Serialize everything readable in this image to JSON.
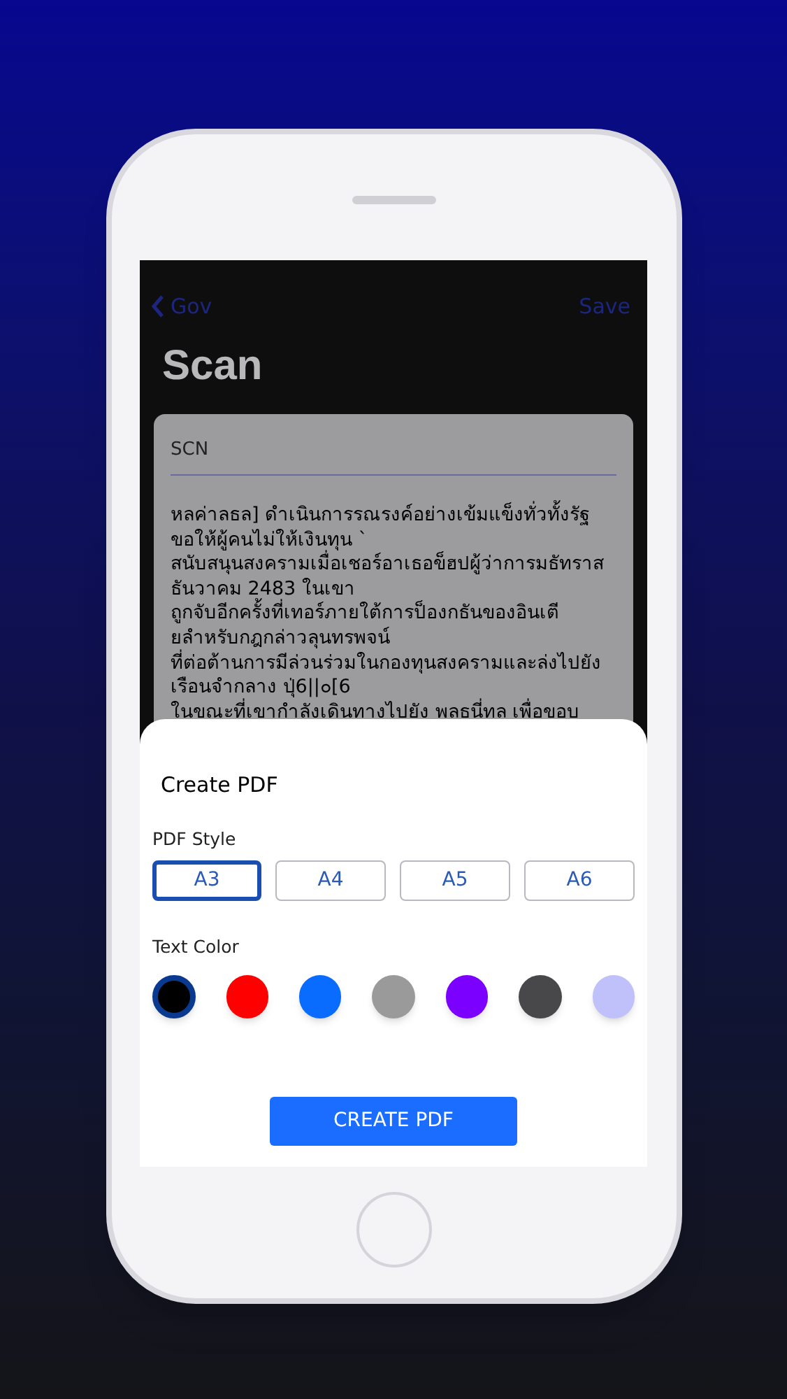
{
  "nav": {
    "back": "Gov",
    "action": "Save"
  },
  "title": "Scan",
  "card": {
    "field_value": "SCN",
    "lines": [
      "หลค่าลธล] ดำเนินการรณรงค์อย่างเข้มแข็งทั่วทั้งรัฐ",
      "ขอให้ผู้คนไม่ให้เงินทุน `",
      "สนับสนุนสงครามเมื่อเชอร์อาเธอข็ฮปผู้ว่าการมธัทราส",
      "ธันวาคม 2483 ในเขา",
      "ถูกจับอีกครั้งที่เทอร์ภายใต้การป็องกธันของอินเตี",
      "ยลำหรับกฎกล่าวลุนทรพจน์",
      "ที่ต่อต้านการมีล่วนร่วมในกองทุนสงครามและล่งไปยัง",
      "เรือนจำกลาง ปุ่6||๐[6",
      "ในขณะที่เขากำลังเดินทางไปยัง พลธนี่ทล เพื่อขอบ"
    ]
  },
  "sheet": {
    "title": "Create PDF",
    "style_label": "PDF Style",
    "styles": [
      {
        "label": "A3",
        "selected": true
      },
      {
        "label": "A4",
        "selected": false
      },
      {
        "label": "A5",
        "selected": false
      },
      {
        "label": "A6",
        "selected": false
      }
    ],
    "color_label": "Text Color",
    "colors": [
      {
        "color": "#000000",
        "selected": true
      },
      {
        "color": "#ff0000",
        "selected": false
      },
      {
        "color": "#0a6cff",
        "selected": false
      },
      {
        "color": "#9a9a9a",
        "selected": false
      },
      {
        "color": "#7b00ff",
        "selected": false
      },
      {
        "color": "#48484a",
        "selected": false
      },
      {
        "color": "#c0c0fa",
        "selected": false
      }
    ],
    "button": "CREATE PDF"
  }
}
